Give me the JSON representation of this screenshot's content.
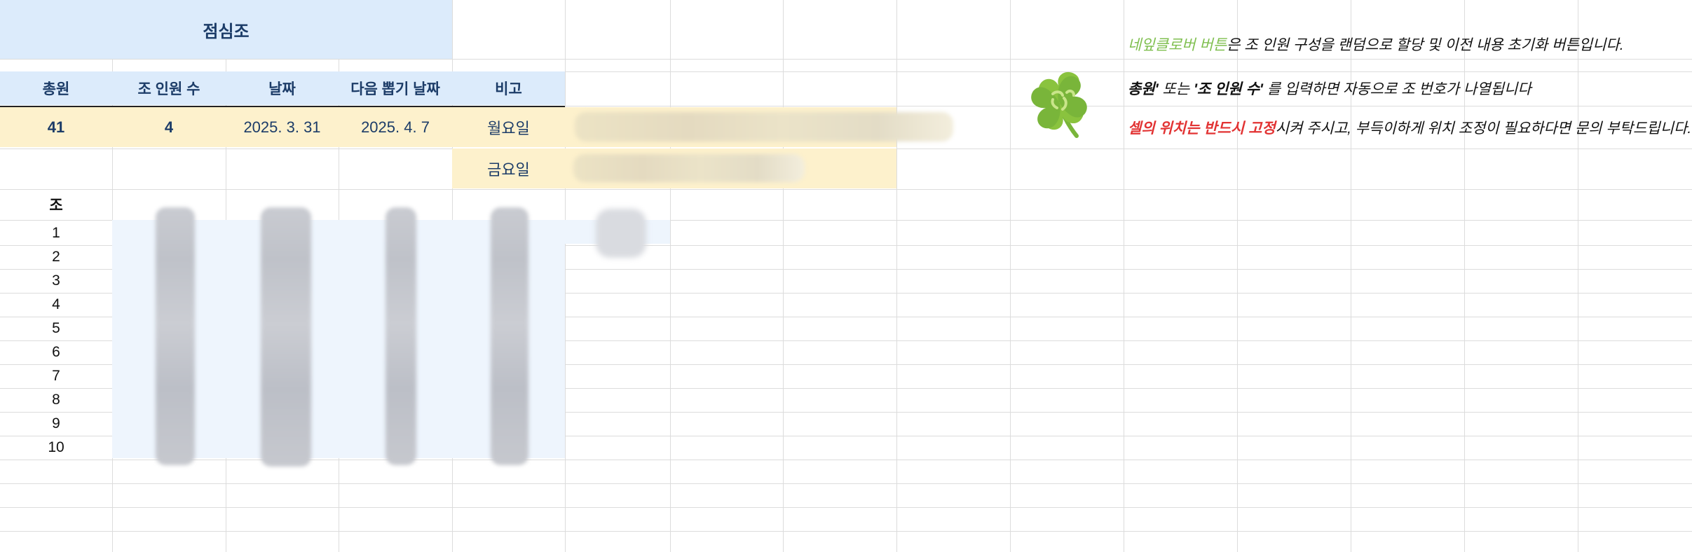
{
  "sheet": {
    "title": "점심조",
    "headers": [
      "총원",
      "조 인원 수",
      "날짜",
      "다음 뽑기 날짜",
      "비고"
    ],
    "values": {
      "total": "41",
      "group_size": "4",
      "date": "2025. 3. 31",
      "next_date": "2025. 4. 7"
    },
    "notes": [
      "월요일",
      "금요일"
    ],
    "group_label": "조",
    "group_numbers": [
      "1",
      "2",
      "3",
      "4",
      "5",
      "6",
      "7",
      "8",
      "9",
      "10"
    ]
  },
  "instructions": {
    "line1": {
      "highlight": "네잎클로버 버튼",
      "rest": "은 조 인원 구성을 랜덤으로 할당 및 이전 내용 초기화 버튼입니다."
    },
    "line2": {
      "p1": "총원'",
      "p2": " 또는 ",
      "p3": "'조 인원 수'",
      "p4": " 를 입력하면 자동으로 조 번호가 나열됩니다"
    },
    "line3": {
      "red": "셀의 위치는 반드시 고정",
      "rest": "시켜 주시고, 부득이하게 위치 조정이 필요하다면 문의 부탁드립니다."
    }
  },
  "clover_button": {
    "icon": "four-leaf-clover-icon"
  },
  "colors": {
    "header_bg": "#dcebfb",
    "header_text": "#1c3c68",
    "value_bg": "#fdf1cc",
    "group_bg": "#eef5fd",
    "highlight_green": "#7fbf4f",
    "warning_red": "#e23333"
  }
}
